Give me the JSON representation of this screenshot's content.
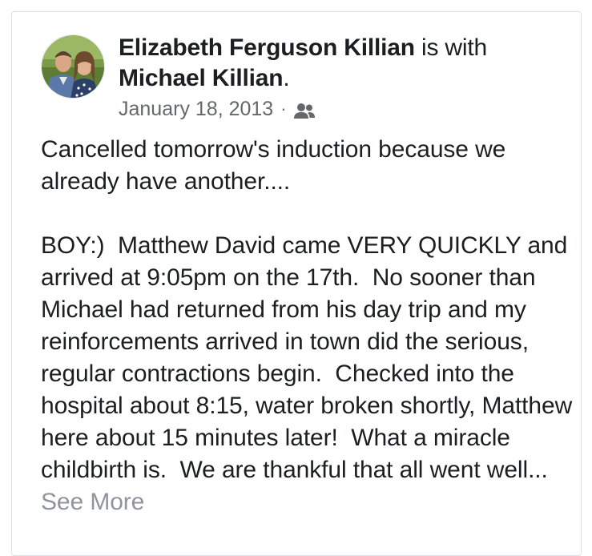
{
  "post": {
    "author": "Elizabeth Ferguson Killian",
    "with_text": " is with",
    "tagged": "Michael Killian",
    "tagged_suffix": ".",
    "date": "January 18, 2013",
    "separator": "·",
    "audience_icon": "friends-icon",
    "paragraph1": "Cancelled tomorrow's induction because we already have another....",
    "paragraph2": "BOY:)  Matthew David came VERY QUICKLY and arrived at 9:05pm on the 17th.  No sooner than Michael had returned from his day trip and my reinforcements arrived in town did the serious, regular contractions begin.  Checked into the hospital about 8:15, water broken shortly, Matthew here about 15 minutes later!  What a miracle childbirth is.  We are thankful that all went well...",
    "see_more": "See More"
  },
  "colors": {
    "text": "#1c1e21",
    "meta": "#65676b",
    "see_more": "#90949c",
    "border": "#dddfe2"
  }
}
